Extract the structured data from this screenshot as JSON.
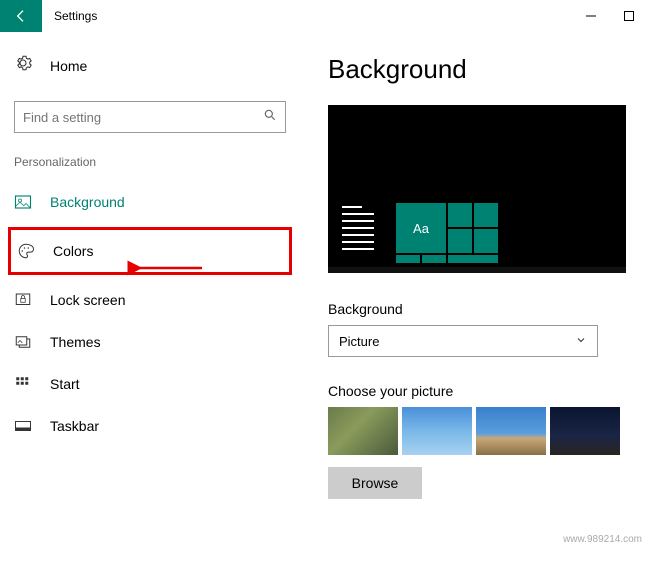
{
  "titlebar": {
    "app_title": "Settings"
  },
  "sidebar": {
    "home_label": "Home",
    "search_placeholder": "Find a setting",
    "section": "Personalization",
    "items": [
      {
        "label": "Background"
      },
      {
        "label": "Colors"
      },
      {
        "label": "Lock screen"
      },
      {
        "label": "Themes"
      },
      {
        "label": "Start"
      },
      {
        "label": "Taskbar"
      }
    ]
  },
  "main": {
    "page_title": "Background",
    "preview_tile_text": "Aa",
    "background_label": "Background",
    "dropdown_value": "Picture",
    "choose_label": "Choose your picture",
    "browse_label": "Browse"
  },
  "watermark": "www.989214.com"
}
